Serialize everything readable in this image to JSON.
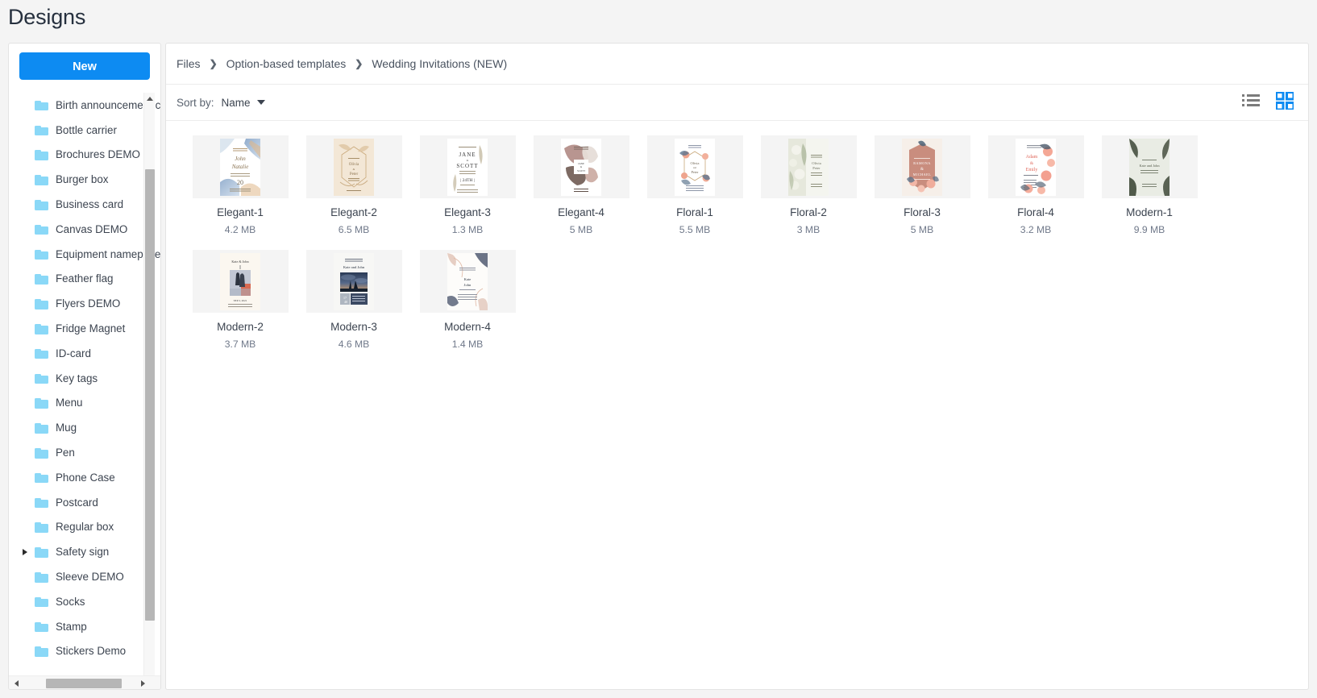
{
  "page": {
    "title": "Designs"
  },
  "sidebar": {
    "new_button": "New",
    "items": [
      {
        "label": "Birth announcement c",
        "expandable": false
      },
      {
        "label": "Bottle carrier",
        "expandable": false
      },
      {
        "label": "Brochures DEMO",
        "expandable": false
      },
      {
        "label": "Burger box",
        "expandable": false
      },
      {
        "label": "Business card",
        "expandable": false
      },
      {
        "label": "Canvas DEMO",
        "expandable": false
      },
      {
        "label": "Equipment nameplate",
        "expandable": false
      },
      {
        "label": "Feather flag",
        "expandable": false
      },
      {
        "label": "Flyers DEMO",
        "expandable": false
      },
      {
        "label": "Fridge Magnet",
        "expandable": false
      },
      {
        "label": "ID-card",
        "expandable": false
      },
      {
        "label": "Key tags",
        "expandable": false
      },
      {
        "label": "Menu",
        "expandable": false
      },
      {
        "label": "Mug",
        "expandable": false
      },
      {
        "label": "Pen",
        "expandable": false
      },
      {
        "label": "Phone Case",
        "expandable": false
      },
      {
        "label": "Postcard",
        "expandable": false
      },
      {
        "label": "Regular box",
        "expandable": false
      },
      {
        "label": "Safety sign",
        "expandable": true
      },
      {
        "label": "Sleeve DEMO",
        "expandable": false
      },
      {
        "label": "Socks",
        "expandable": false
      },
      {
        "label": "Stamp",
        "expandable": false
      },
      {
        "label": "Stickers Demo",
        "expandable": false
      }
    ]
  },
  "breadcrumb": {
    "separator": "❯",
    "crumbs": [
      "Files",
      "Option-based templates",
      "Wedding Invitations (NEW)"
    ]
  },
  "toolbar": {
    "sort_label": "Sort by:",
    "sort_value": "Name",
    "list_view_icon": "list-view-icon",
    "grid_view_icon": "grid-view-icon",
    "active_view": "grid",
    "active_color": "#0d8bf2",
    "inactive_color": "#7b7b7b"
  },
  "files": [
    {
      "name": "Elegant-1",
      "size": "4.2 MB",
      "style": "elegant1"
    },
    {
      "name": "Elegant-2",
      "size": "6.5 MB",
      "style": "elegant2"
    },
    {
      "name": "Elegant-3",
      "size": "1.3 MB",
      "style": "elegant3"
    },
    {
      "name": "Elegant-4",
      "size": "5 MB",
      "style": "elegant4"
    },
    {
      "name": "Floral-1",
      "size": "5.5 MB",
      "style": "floral1"
    },
    {
      "name": "Floral-2",
      "size": "3 MB",
      "style": "floral2"
    },
    {
      "name": "Floral-3",
      "size": "5 MB",
      "style": "floral3"
    },
    {
      "name": "Floral-4",
      "size": "3.2 MB",
      "style": "floral4"
    },
    {
      "name": "Modern-1",
      "size": "9.9 MB",
      "style": "modern1"
    },
    {
      "name": "Modern-2",
      "size": "3.7 MB",
      "style": "modern2"
    },
    {
      "name": "Modern-3",
      "size": "4.6 MB",
      "style": "modern3"
    },
    {
      "name": "Modern-4",
      "size": "1.4 MB",
      "style": "modern4"
    }
  ]
}
